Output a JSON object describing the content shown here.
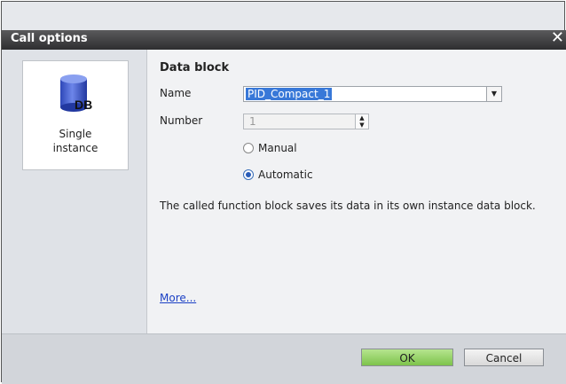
{
  "dialog": {
    "title": "Call options",
    "close_icon": "close-icon"
  },
  "tile": {
    "icon_text": "DB",
    "label_line1": "Single",
    "label_line2": "instance"
  },
  "data_block": {
    "heading": "Data block",
    "name_label": "Name",
    "name_value": "PID_Compact_1",
    "number_label": "Number",
    "number_value": "1",
    "radio_manual": "Manual",
    "radio_automatic": "Automatic",
    "selected": "Automatic",
    "description": "The called function block saves its data in its own instance data block.",
    "more_link": "More..."
  },
  "buttons": {
    "ok": "OK",
    "cancel": "Cancel"
  },
  "colors": {
    "titlebar": "#3c3c3e",
    "ok_button": "#8fd060",
    "selection": "#3878d8"
  }
}
